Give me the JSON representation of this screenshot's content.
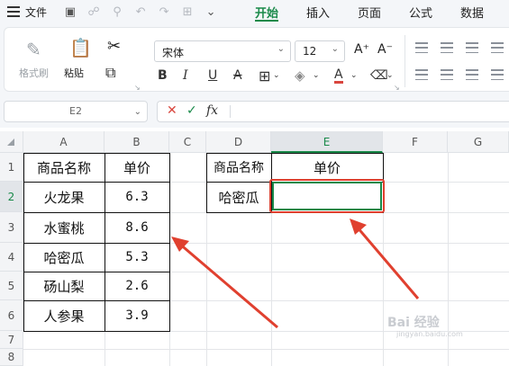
{
  "menu": {
    "file_label": "文件",
    "tabs": [
      "开始",
      "插入",
      "页面",
      "公式",
      "数据"
    ],
    "active_tab": "开始"
  },
  "ribbon": {
    "format_painter": "格式刷",
    "paste": "粘贴",
    "font_name": "宋体",
    "font_size": "12",
    "bold": "B",
    "italic": "I",
    "underline": "U",
    "strike": "A",
    "font_color": "A",
    "font_grow": "A⁺",
    "font_shrink": "A⁻"
  },
  "formula_bar": {
    "name_box": "E2",
    "cancel": "✕",
    "confirm": "✓",
    "fx": "fx",
    "content": ""
  },
  "grid": {
    "columns": [
      "A",
      "B",
      "C",
      "D",
      "E",
      "F",
      "G"
    ],
    "rows": [
      "1",
      "2",
      "3",
      "4",
      "5",
      "6",
      "7",
      "8"
    ],
    "selected_cell": "E2",
    "table1": {
      "headers": [
        "商品名称",
        "单价"
      ],
      "rows": [
        [
          "火龙果",
          "6.3"
        ],
        [
          "水蜜桃",
          "8.6"
        ],
        [
          "哈密瓜",
          "5.3"
        ],
        [
          "砀山梨",
          "2.6"
        ],
        [
          "人参果",
          "3.9"
        ]
      ]
    },
    "table2": {
      "headers": [
        "商品名称",
        "单价"
      ],
      "rows": [
        [
          "哈密瓜",
          ""
        ]
      ]
    }
  },
  "colors": {
    "accent_green": "#1a8a4a",
    "annotation_red": "#e0402f"
  },
  "watermark": {
    "brand": "Bai 经验",
    "url": "jingyan.baidu.com"
  }
}
